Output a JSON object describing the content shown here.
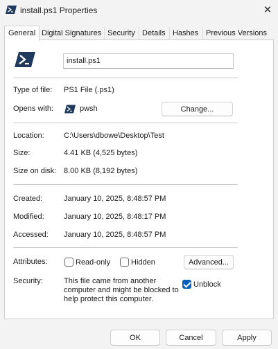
{
  "window": {
    "title": "install.ps1 Properties",
    "close_label": "✕"
  },
  "tabs": [
    {
      "label": "General",
      "active": true
    },
    {
      "label": "Digital Signatures",
      "active": false
    },
    {
      "label": "Security",
      "active": false
    },
    {
      "label": "Details",
      "active": false
    },
    {
      "label": "Hashes",
      "active": false
    },
    {
      "label": "Previous Versions",
      "active": false
    }
  ],
  "general": {
    "file_name": "install.ps1",
    "type_label": "Type of file:",
    "type_value": "PS1 File (.ps1)",
    "opens_label": "Opens with:",
    "opens_value": "pwsh",
    "change_button": "Change...",
    "location_label": "Location:",
    "location_value": "C:\\Users\\dbowe\\Desktop\\Test",
    "size_label": "Size:",
    "size_value": "4.41 KB (4,525 bytes)",
    "size_on_disk_label": "Size on disk:",
    "size_on_disk_value": "8.00 KB (8,192 bytes)",
    "created_label": "Created:",
    "created_value": "January 10, 2025, 8:48:57 PM",
    "modified_label": "Modified:",
    "modified_value": "January 10, 2025, 8:48:17 PM",
    "accessed_label": "Accessed:",
    "accessed_value": "January 10, 2025, 8:48:57 PM",
    "attributes_label": "Attributes:",
    "readonly_label": "Read-only",
    "readonly_checked": false,
    "hidden_label": "Hidden",
    "hidden_checked": false,
    "advanced_button": "Advanced...",
    "security_label": "Security:",
    "security_text_1": "This file came from another",
    "security_text_2": "computer and might be blocked to",
    "security_text_3": "help protect this computer.",
    "unblock_label": "Unblock",
    "unblock_checked": true
  },
  "footer": {
    "ok": "OK",
    "cancel": "Cancel",
    "apply": "Apply"
  },
  "colors": {
    "powershell_icon": "#1f3a5c",
    "accent": "#005fb8"
  }
}
